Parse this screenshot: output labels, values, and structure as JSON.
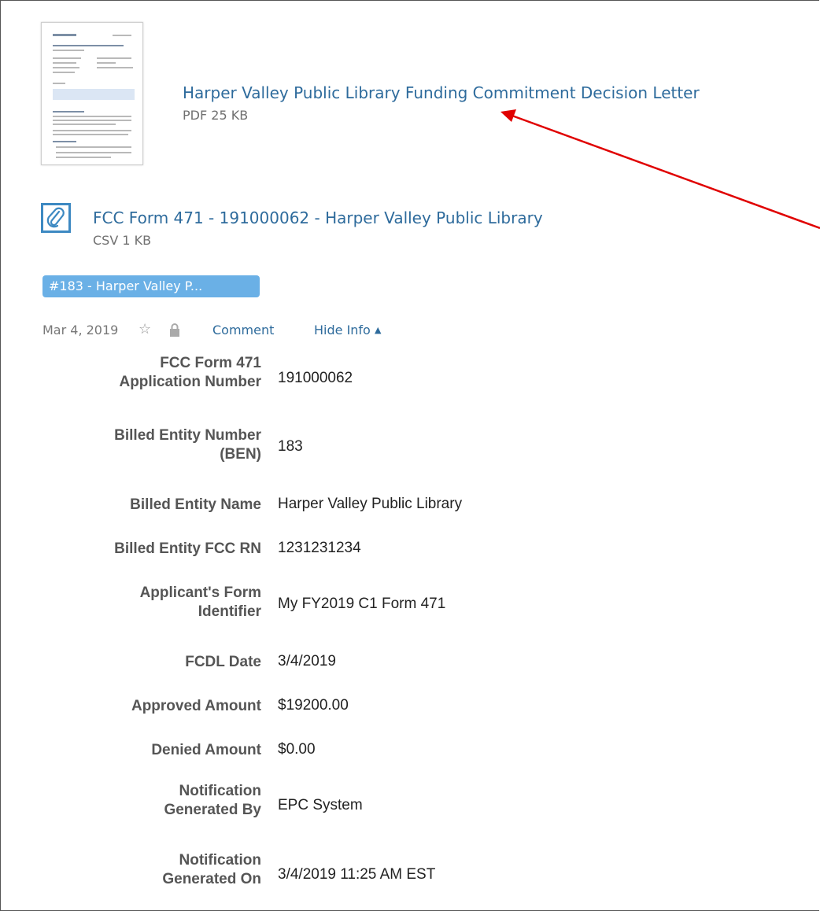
{
  "files": [
    {
      "title": "Harper Valley Public Library Funding Commitment Decision Letter",
      "meta": "PDF 25 KB",
      "icon": "pdf-thumbnail"
    },
    {
      "title": "FCC Form 471 - 191000062 - Harper Valley Public Library",
      "meta": "CSV 1 KB",
      "icon": "paperclip-icon"
    }
  ],
  "tag": "#183 - Harper Valley P...",
  "meta": {
    "date": "Mar 4, 2019",
    "comment_label": "Comment",
    "hide_info_label": "Hide Info",
    "hide_info_glyph": "▲",
    "star_glyph": "☆"
  },
  "info": [
    {
      "label_lines": [
        "FCC Form 471",
        "Application Number"
      ],
      "value": "191000062"
    },
    {
      "label_lines": [
        "Billed Entity Number",
        "(BEN)"
      ],
      "value": "183"
    },
    {
      "label_lines": [
        "Billed Entity Name"
      ],
      "value": "Harper Valley Public Library"
    },
    {
      "label_lines": [
        "Billed Entity FCC RN"
      ],
      "value": "1231231234"
    },
    {
      "label_lines": [
        "Applicant's Form",
        "Identifier"
      ],
      "value": "My FY2019 C1 Form 471"
    },
    {
      "label_lines": [
        "FCDL Date"
      ],
      "value": "3/4/2019"
    },
    {
      "label_lines": [
        "Approved Amount"
      ],
      "value": "$19200.00"
    },
    {
      "label_lines": [
        "Denied Amount"
      ],
      "value": "$0.00"
    },
    {
      "label_lines": [
        "Notification",
        "Generated By"
      ],
      "value": "EPC System"
    },
    {
      "label_lines": [
        "Notification",
        "Generated On"
      ],
      "value": "3/4/2019 11:25 AM EST"
    }
  ],
  "colors": {
    "link": "#2e6b9c",
    "tag_bg": "#6ab0e6",
    "annotation_arrow": "#e00000"
  }
}
